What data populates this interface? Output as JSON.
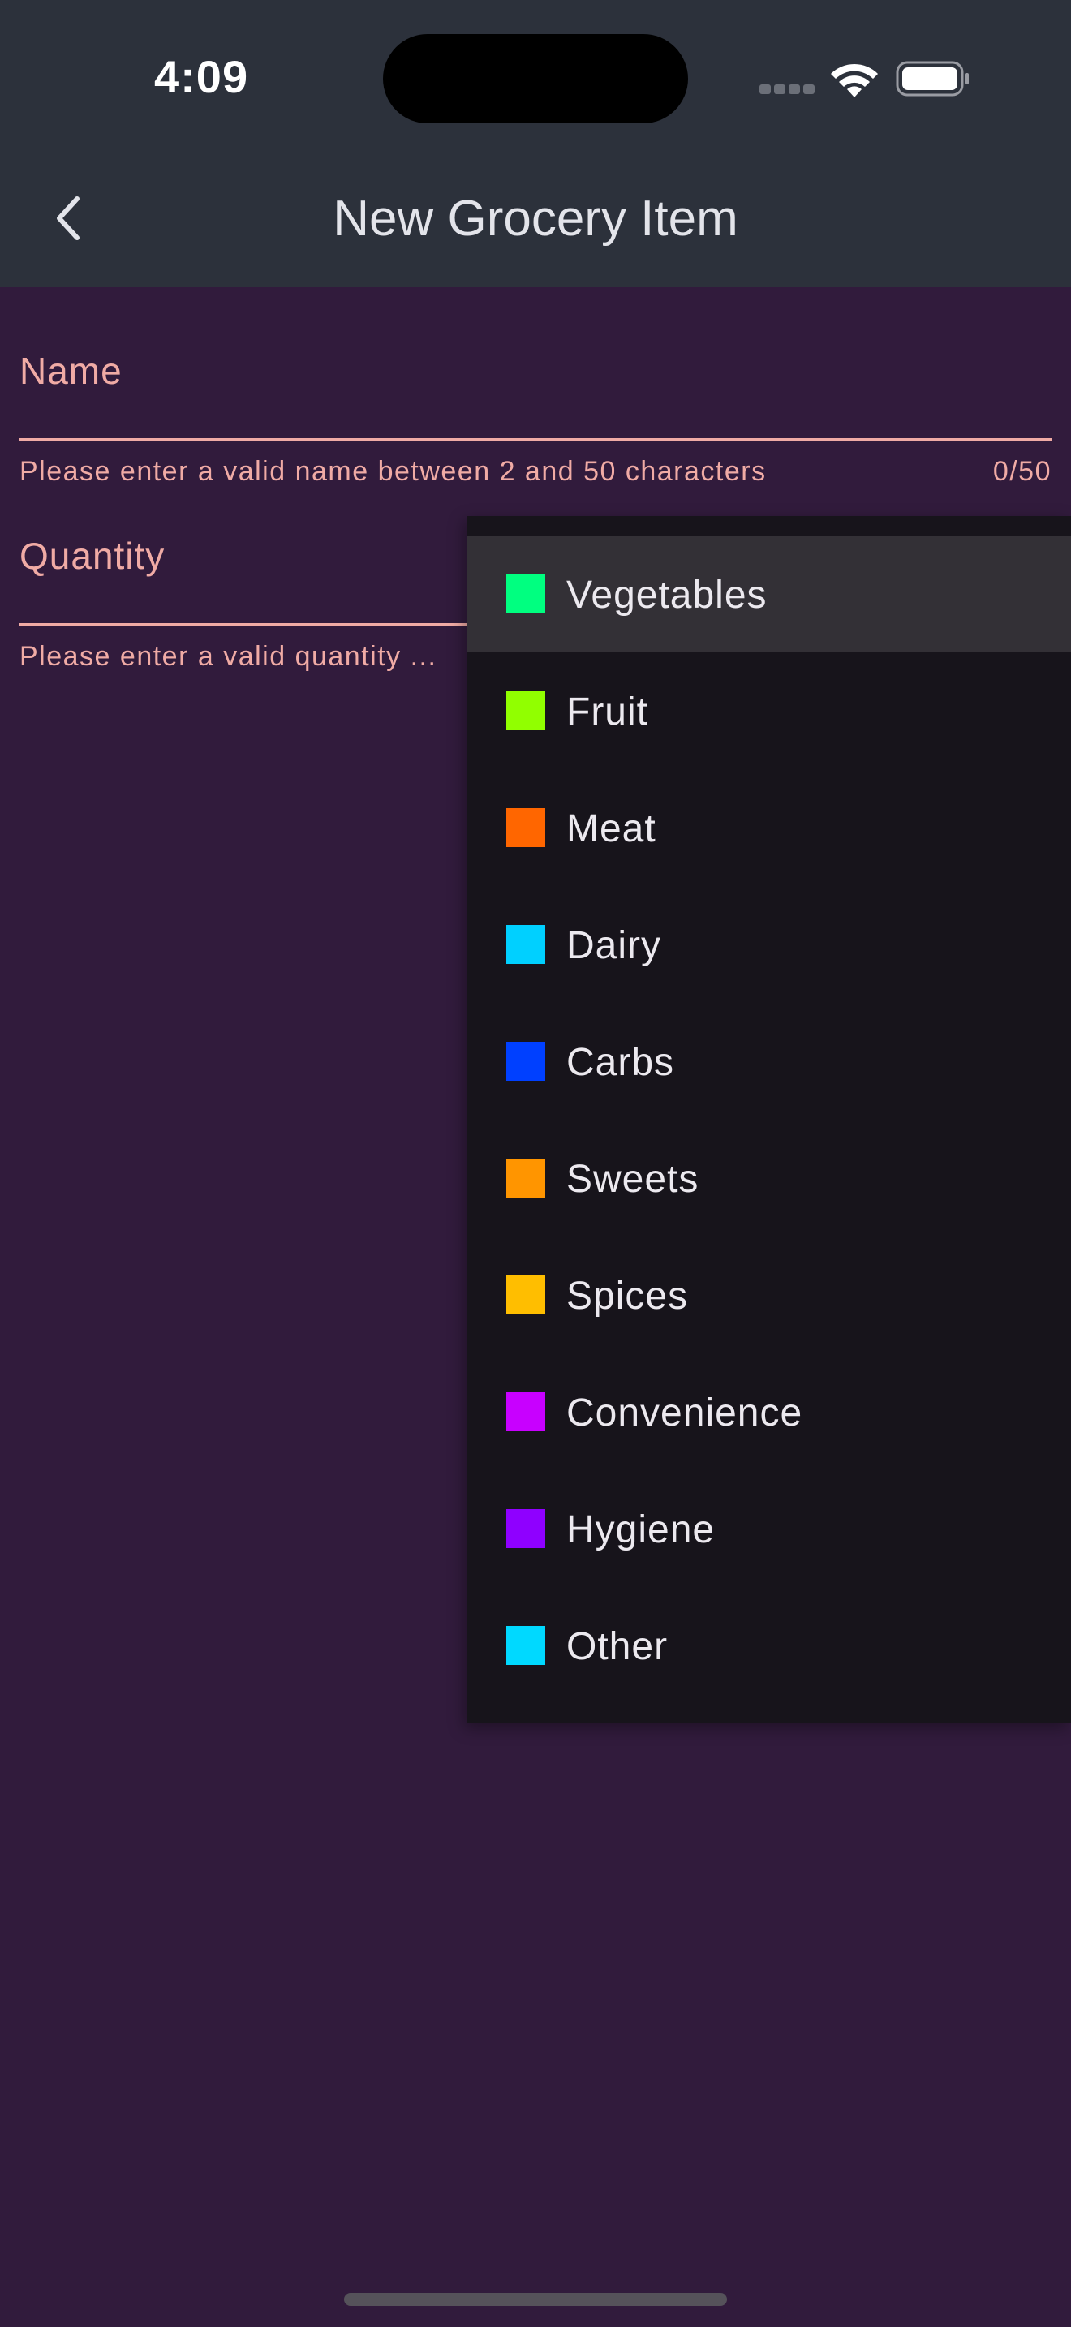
{
  "status_bar": {
    "time": "4:09"
  },
  "app_bar": {
    "title": "New Grocery Item",
    "back_icon": "chevron-left-icon"
  },
  "form": {
    "name": {
      "label": "Name",
      "value": "",
      "error": "Please enter a valid name between 2 and 50 characters",
      "counter": "0/50"
    },
    "quantity": {
      "label": "Quantity",
      "value": "",
      "error": "Please enter a valid quantity ..."
    }
  },
  "category_menu": {
    "selected": "Vegetables",
    "items": [
      {
        "label": "Vegetables",
        "color": "#00ff80"
      },
      {
        "label": "Fruit",
        "color": "#91ff00"
      },
      {
        "label": "Meat",
        "color": "#ff6600"
      },
      {
        "label": "Dairy",
        "color": "#00d0ff"
      },
      {
        "label": "Carbs",
        "color": "#0040ff"
      },
      {
        "label": "Sweets",
        "color": "#ff9500"
      },
      {
        "label": "Spices",
        "color": "#ffbe00"
      },
      {
        "label": "Convenience",
        "color": "#c800ff"
      },
      {
        "label": "Hygiene",
        "color": "#8f00ff"
      },
      {
        "label": "Other",
        "color": "#00d9ff"
      }
    ]
  }
}
